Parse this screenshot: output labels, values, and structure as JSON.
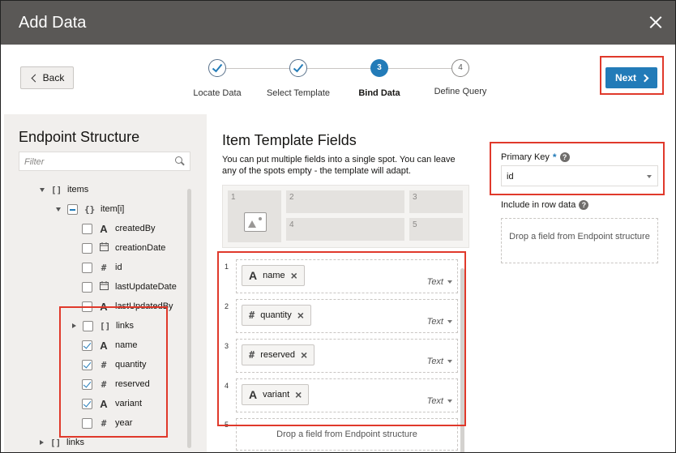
{
  "dialog": {
    "title": "Add Data"
  },
  "nav": {
    "back_label": "Back",
    "next_label": "Next"
  },
  "steps": [
    {
      "label": "Locate Data",
      "state": "done"
    },
    {
      "label": "Select Template",
      "state": "done"
    },
    {
      "label": "Bind Data",
      "state": "current",
      "number": "3"
    },
    {
      "label": "Define Query",
      "state": "todo",
      "number": "4"
    }
  ],
  "endpoint": {
    "title": "Endpoint Structure",
    "filter_placeholder": "Filter",
    "tree": [
      {
        "label": "items",
        "icon": "array-icon",
        "expander": "expanded"
      },
      {
        "label": "item[i]",
        "icon": "object-icon",
        "expander": "expanded",
        "check": "mixed"
      },
      {
        "label": "createdBy",
        "icon": "text-icon",
        "check": "unchecked"
      },
      {
        "label": "creationDate",
        "icon": "date-icon",
        "check": "unchecked"
      },
      {
        "label": "id",
        "icon": "number-icon",
        "check": "unchecked"
      },
      {
        "label": "lastUpdateDate",
        "icon": "date-icon",
        "check": "unchecked"
      },
      {
        "label": "lastUpdatedBy",
        "icon": "text-icon",
        "check": "unchecked"
      },
      {
        "label": "links",
        "icon": "array-icon",
        "expander": "collapsed",
        "check": "unchecked"
      },
      {
        "label": "name",
        "icon": "text-icon",
        "check": "checked"
      },
      {
        "label": "quantity",
        "icon": "number-icon",
        "check": "checked"
      },
      {
        "label": "reserved",
        "icon": "number-icon",
        "check": "checked"
      },
      {
        "label": "variant",
        "icon": "text-icon",
        "check": "checked"
      },
      {
        "label": "year",
        "icon": "number-icon",
        "check": "unchecked"
      },
      {
        "label": "links",
        "icon": "array-icon",
        "expander": "collapsed"
      }
    ]
  },
  "template": {
    "title": "Item Template Fields",
    "description": "You can put multiple fields into a single spot. You can leave any of the spots empty - the template will adapt.",
    "cells": [
      "1",
      "2",
      "3",
      "4",
      "5"
    ]
  },
  "slots": [
    {
      "number": "1",
      "field": "name",
      "icon": "text-icon",
      "type": "Text"
    },
    {
      "number": "2",
      "field": "quantity",
      "icon": "number-icon",
      "type": "Text"
    },
    {
      "number": "3",
      "field": "reserved",
      "icon": "number-icon",
      "type": "Text"
    },
    {
      "number": "4",
      "field": "variant",
      "icon": "text-icon",
      "type": "Text"
    },
    {
      "number": "5",
      "drop_text": "Drop a field from Endpoint structure"
    }
  ],
  "primary_key": {
    "label": "Primary Key",
    "required_mark": "*",
    "value": "id",
    "help": "?"
  },
  "row_data": {
    "label": "Include in row data",
    "help": "?",
    "drop_text": "Drop a field from Endpoint structure"
  },
  "icons": {
    "text-icon": "A",
    "number-icon": "#",
    "array-icon": "[]",
    "object-icon": "{}",
    "date-icon": "📅"
  },
  "colors": {
    "accent": "#227bb8",
    "highlight": "#e0392b",
    "titlebar": "#5a5856"
  }
}
